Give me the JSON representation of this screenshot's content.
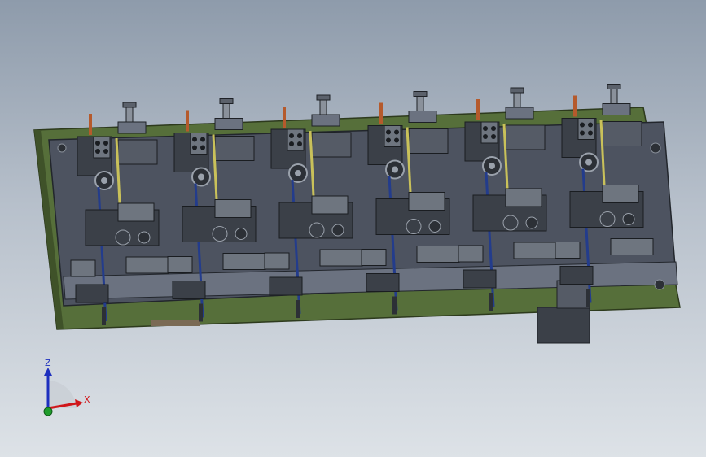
{
  "window": {
    "title": ""
  },
  "colors": {
    "background_top": "#8e9bab",
    "background_bottom": "#dde2e7",
    "base_plate_green": "#566f3a",
    "base_plate_dark": "#3f5229",
    "steel_plate": "#4d5360",
    "steel_light": "#6b7280",
    "part_dark": "#3b4048",
    "rod_blue": "#233c8c",
    "rod_yellow": "#c9c15a",
    "pin_orange": "#b55a2c",
    "axis_x": "#d0161a",
    "axis_y": "#1f9c2b",
    "axis_z": "#1d2fbf"
  },
  "triad": {
    "x_label": "X",
    "z_label": "Z"
  },
  "model": {
    "station_count": 6
  }
}
